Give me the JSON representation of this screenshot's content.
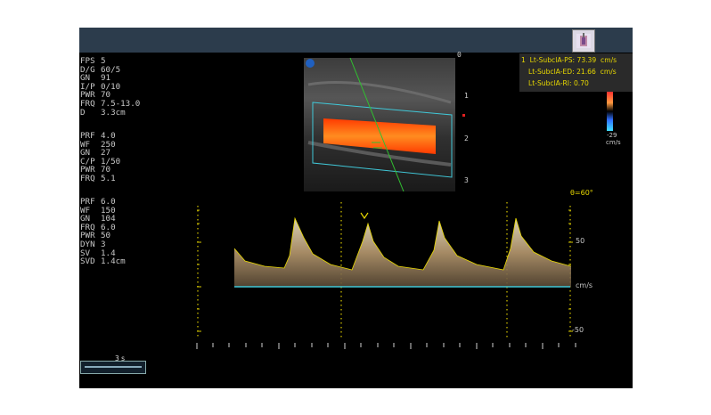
{
  "params_block1": [
    {
      "label": "FPS",
      "value": "5"
    },
    {
      "label": "D/G",
      "value": "60/5"
    },
    {
      "label": "GN",
      "value": "91"
    },
    {
      "label": "I/P",
      "value": "0/10"
    },
    {
      "label": "PWR",
      "value": "70"
    },
    {
      "label": "FRQ",
      "value": "7.5-13.0"
    },
    {
      "label": "D",
      "value": "3.3cm"
    }
  ],
  "params_block2": [
    {
      "label": "PRF",
      "value": "4.0"
    },
    {
      "label": "WF",
      "value": "250"
    },
    {
      "label": "GN",
      "value": "27"
    },
    {
      "label": "C/P",
      "value": "1/50"
    },
    {
      "label": "PWR",
      "value": "70"
    },
    {
      "label": "FRQ",
      "value": "5.1"
    }
  ],
  "params_block3": [
    {
      "label": "PRF",
      "value": "6.0"
    },
    {
      "label": "WF",
      "value": "150"
    },
    {
      "label": "GN",
      "value": "104"
    },
    {
      "label": "FRQ",
      "value": "6.0"
    },
    {
      "label": "PWR",
      "value": "50"
    },
    {
      "label": "DYN",
      "value": "3"
    },
    {
      "label": "SV",
      "value": "1.4"
    },
    {
      "label": "SVD",
      "value": "1.4cm"
    }
  ],
  "measurements": [
    "1  Lt-SubclA-PS: 73.39  cm/s",
    "Lt-SubclA-ED: 21.66  cm/s",
    "Lt-SubclA-RI: 0.70"
  ],
  "depth_scale": [
    "0",
    "1",
    "2",
    "3"
  ],
  "color_bar": {
    "top_value": "",
    "bottom_value": "-29",
    "unit": "cm/s"
  },
  "spectral": {
    "angle": "θ=60°",
    "velocity_labels": [
      "50",
      "cm/s",
      "-50"
    ],
    "time_scale": "3 s"
  },
  "colors": {
    "accent_yellow": "#e8d800",
    "baseline_cyan": "#40c8d8",
    "flow_orange": "#ff6a10",
    "screen_bg": "#000000"
  }
}
